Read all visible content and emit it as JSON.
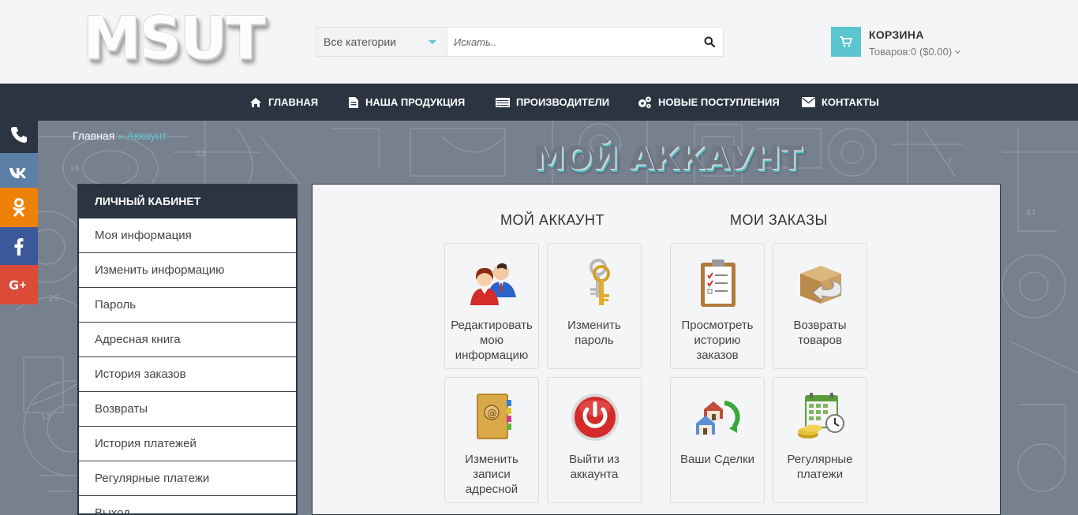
{
  "header": {
    "logo_text": "MSUT",
    "category_select": "Все категории",
    "search_placeholder": "Искать..",
    "cart_title": "КОРЗИНА",
    "cart_summary": "Товаров:0 ($0.00)"
  },
  "nav": {
    "items": [
      {
        "label": "ГЛАВНАЯ",
        "icon": "home-icon"
      },
      {
        "label": "НАША ПРОДУКЦИЯ",
        "icon": "file-icon"
      },
      {
        "label": "ПРОИЗВОДИТЕЛИ",
        "icon": "list-icon"
      },
      {
        "label": "НОВЫЕ ПОСТУПЛЕНИЯ",
        "icon": "gears-icon"
      },
      {
        "label": "КОНТАКТЫ",
        "icon": "envelope-icon"
      }
    ]
  },
  "social": [
    {
      "name": "phone-icon",
      "color": "#2b3441"
    },
    {
      "name": "vk-icon",
      "color": "#5b7fa6"
    },
    {
      "name": "odnoklassniki-icon",
      "color": "#ee8208"
    },
    {
      "name": "facebook-icon",
      "color": "#3b5998"
    },
    {
      "name": "google-plus-icon",
      "color": "#dc4a38"
    }
  ],
  "breadcrumb": {
    "home": "Главная",
    "separator": "»",
    "current": "Аккаунт"
  },
  "page_title": "МОЙ АККАУНТ",
  "sidebar": {
    "title": "ЛИЧНЫЙ КАБИНЕТ",
    "items": [
      "Моя информация",
      "Изменить информацию",
      "Пароль",
      "Адресная книга",
      "История заказов",
      "Возвраты",
      "История платежей",
      "Регулярные платежи",
      "Выход"
    ]
  },
  "account_section": {
    "title": "МОЙ АККАУНТ",
    "tiles": [
      {
        "label": "Редактировать мою информацию",
        "icon": "users-icon"
      },
      {
        "label": "Изменить пароль",
        "icon": "keys-icon"
      },
      {
        "label": "Изменить записи адресной",
        "icon": "address-book-icon"
      },
      {
        "label": "Выйти из аккаунта",
        "icon": "power-icon"
      }
    ]
  },
  "orders_section": {
    "title": "МОИ ЗАКАЗЫ",
    "tiles": [
      {
        "label": "Просмотреть историю заказов",
        "icon": "clipboard-icon"
      },
      {
        "label": "Возвраты товаров",
        "icon": "return-box-icon"
      },
      {
        "label": "Ваши Сделки",
        "icon": "house-deals-icon"
      },
      {
        "label": "Регулярные платежи",
        "icon": "calendar-coins-icon"
      }
    ]
  },
  "colors": {
    "accent": "#5bc6d0",
    "nav_bg": "#2b3441"
  }
}
